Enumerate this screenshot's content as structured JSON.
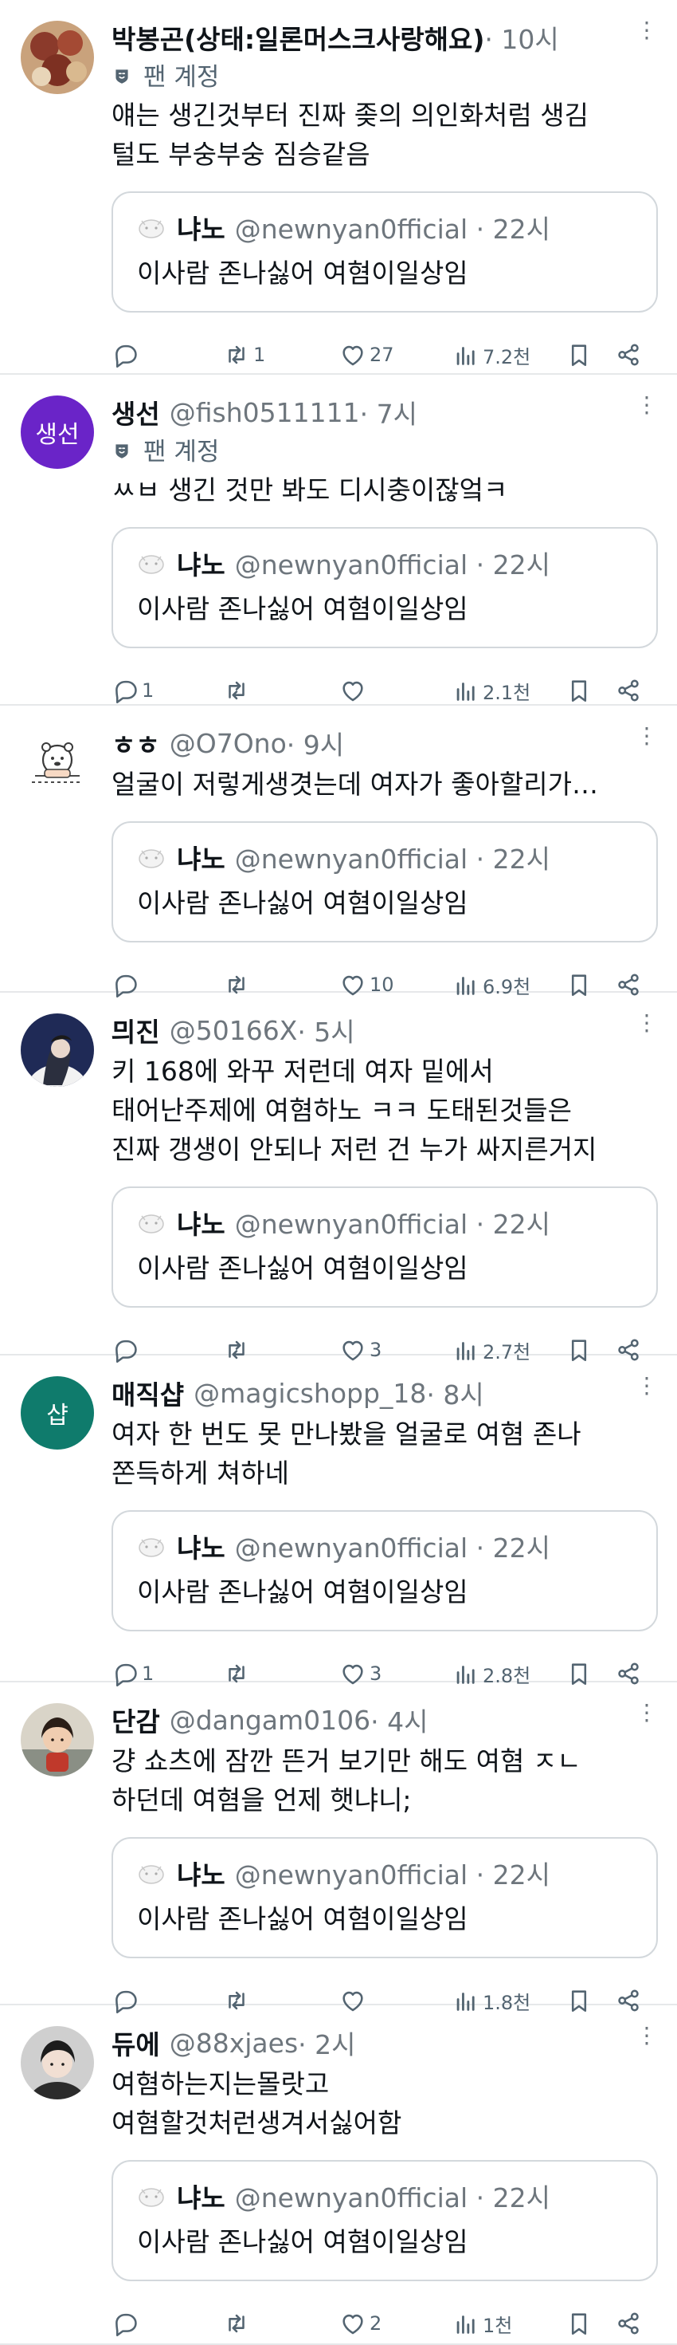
{
  "quoted": {
    "name": "냐노",
    "handle": "@newnyan0fficial · 22시",
    "text": "이사람 존나싫어 여혐이일상임"
  },
  "fan_label": "팬 계정",
  "more_glyph": "⋮",
  "colors": {
    "text": "#0f1419",
    "secondary": "#536471",
    "border": "#e6e8ea"
  },
  "tweets": [
    {
      "name": "박봉곤(상태:일론머스크사랑해요)",
      "handle": "",
      "time": " · 10시",
      "fan": true,
      "avatar": "photo-avatar-dumplings",
      "lines": [
        "얘는 생긴것부터 진짜 좆의 의인화처럼 생김",
        "털도 부숭부숭 짐승같음"
      ],
      "reply": "",
      "retweet": "1",
      "like": "27",
      "views": "7.2천"
    },
    {
      "name": "생선",
      "handle": "@fish0511111",
      "time": " · 7시",
      "fan": true,
      "avatar": "text-avatar",
      "avatar_text": "생선",
      "avatar_color": "#6a24c8",
      "lines": [
        "ㅆㅂ 생긴 것만 봐도 디시충이잖엌ㅋ"
      ],
      "reply": "1",
      "retweet": "",
      "like": "",
      "views": "2.1천"
    },
    {
      "name": "ㅎㅎ",
      "handle": "@O7Ono",
      "time": " · 9시",
      "fan": false,
      "avatar": "cartoon-bear-avatar",
      "lines": [
        "얼굴이 저렇게생겻는데 여자가 좋아할리가…"
      ],
      "reply": "",
      "retweet": "",
      "like": "10",
      "views": "6.9천"
    },
    {
      "name": "믜진",
      "handle": "@50166X",
      "time": " · 5시",
      "fan": false,
      "avatar": "photo-avatar-dark",
      "lines": [
        "키 168에 와꾸 저런데 여자 밑에서",
        "태어난주제에 여혐하노 ㅋㅋ 도태된것들은",
        "진짜 갱생이 안되나 저런 건 누가 싸지른거지"
      ],
      "reply": "",
      "retweet": "",
      "like": "3",
      "views": "2.7천"
    },
    {
      "name": "매직샵",
      "handle": "@magicshopp_18",
      "time": " · 8시",
      "fan": false,
      "avatar": "text-avatar",
      "avatar_text": "샵",
      "avatar_color": "#0f7b6c",
      "lines": [
        "여자 한 번도 못 만나봤을 얼굴로 여혐 존나",
        "쫀득하게 쳐하네"
      ],
      "reply": "1",
      "retweet": "",
      "like": "3",
      "views": "2.8천"
    },
    {
      "name": "단감",
      "handle": "@dangam0106",
      "time": " · 4시",
      "fan": false,
      "avatar": "photo-avatar-child",
      "lines": [
        "걍 쇼츠에 잠깐 뜬거 보기만 해도 여혐 ㅈㄴ",
        "하던데 여혐을 언제 햇냐니;"
      ],
      "reply": "",
      "retweet": "",
      "like": "",
      "views": "1.8천"
    },
    {
      "name": "듀에",
      "handle": "@88xjaes",
      "time": " · 2시",
      "fan": false,
      "avatar": "photo-avatar-person",
      "lines": [
        "여혐하는지는몰랏고",
        "여혐할것처런생겨서싫어함"
      ],
      "reply": "",
      "retweet": "",
      "like": "2",
      "views": "1천"
    }
  ]
}
